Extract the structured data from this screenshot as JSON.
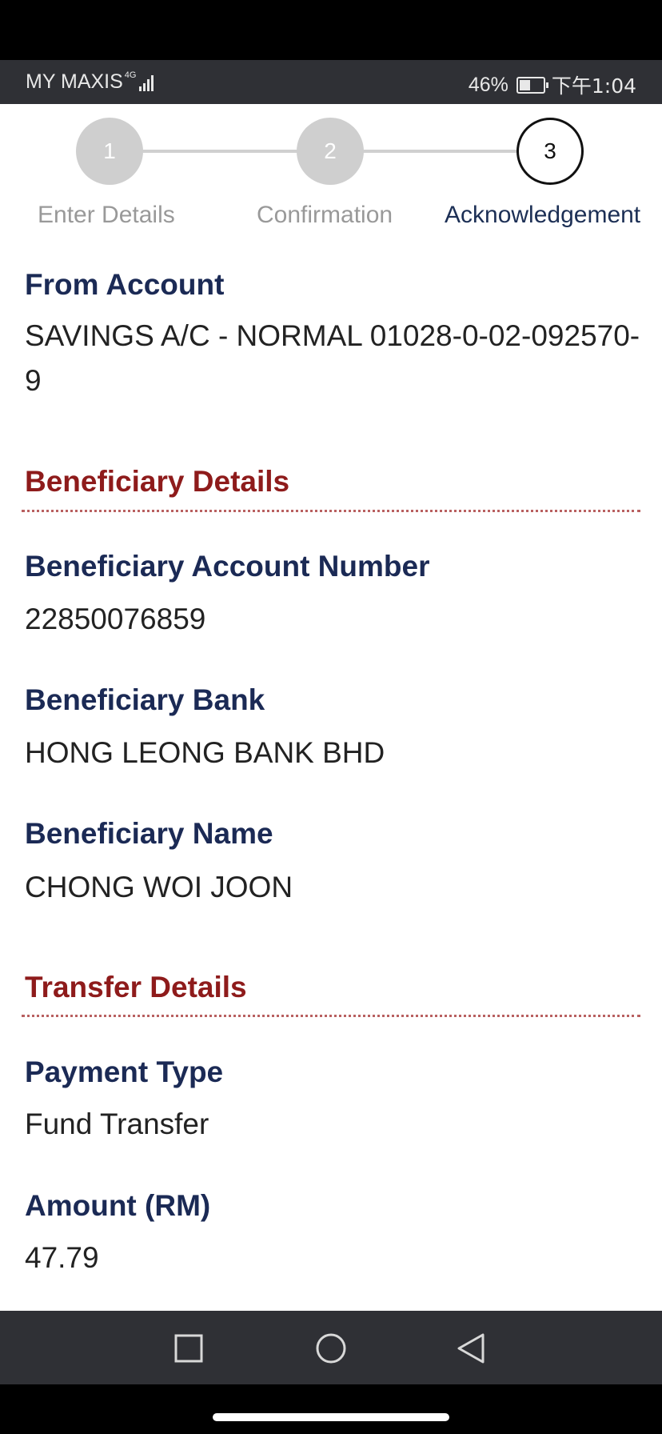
{
  "status_bar": {
    "carrier": "MY MAXIS",
    "network": "4G",
    "battery": "46%",
    "time": "下午1:04"
  },
  "stepper": {
    "steps": [
      {
        "number": "1",
        "label": "Enter Details",
        "state": "done"
      },
      {
        "number": "2",
        "label": "Confirmation",
        "state": "done"
      },
      {
        "number": "3",
        "label": "Acknowledgement",
        "state": "current"
      }
    ]
  },
  "from_account": {
    "label": "From Account",
    "value": "SAVINGS A/C - NORMAL 01028-0-02-092570-9"
  },
  "beneficiary": {
    "section_title": "Beneficiary Details",
    "account_number_label": "Beneficiary Account Number",
    "account_number": "22850076859",
    "bank_label": "Beneficiary Bank",
    "bank": "HONG LEONG BANK BHD",
    "name_label": "Beneficiary Name",
    "name": "CHONG WOI JOON"
  },
  "transfer": {
    "section_title": "Transfer Details",
    "payment_type_label": "Payment Type",
    "payment_type": "Fund Transfer",
    "amount_label": "Amount (RM)",
    "amount": "47.79"
  },
  "nav": {
    "icons": [
      "recent-apps-icon",
      "home-icon",
      "back-icon"
    ]
  },
  "colors": {
    "label_navy": "#1b2a55",
    "section_red": "#8e1b1b",
    "system_bar": "#2f3035"
  }
}
